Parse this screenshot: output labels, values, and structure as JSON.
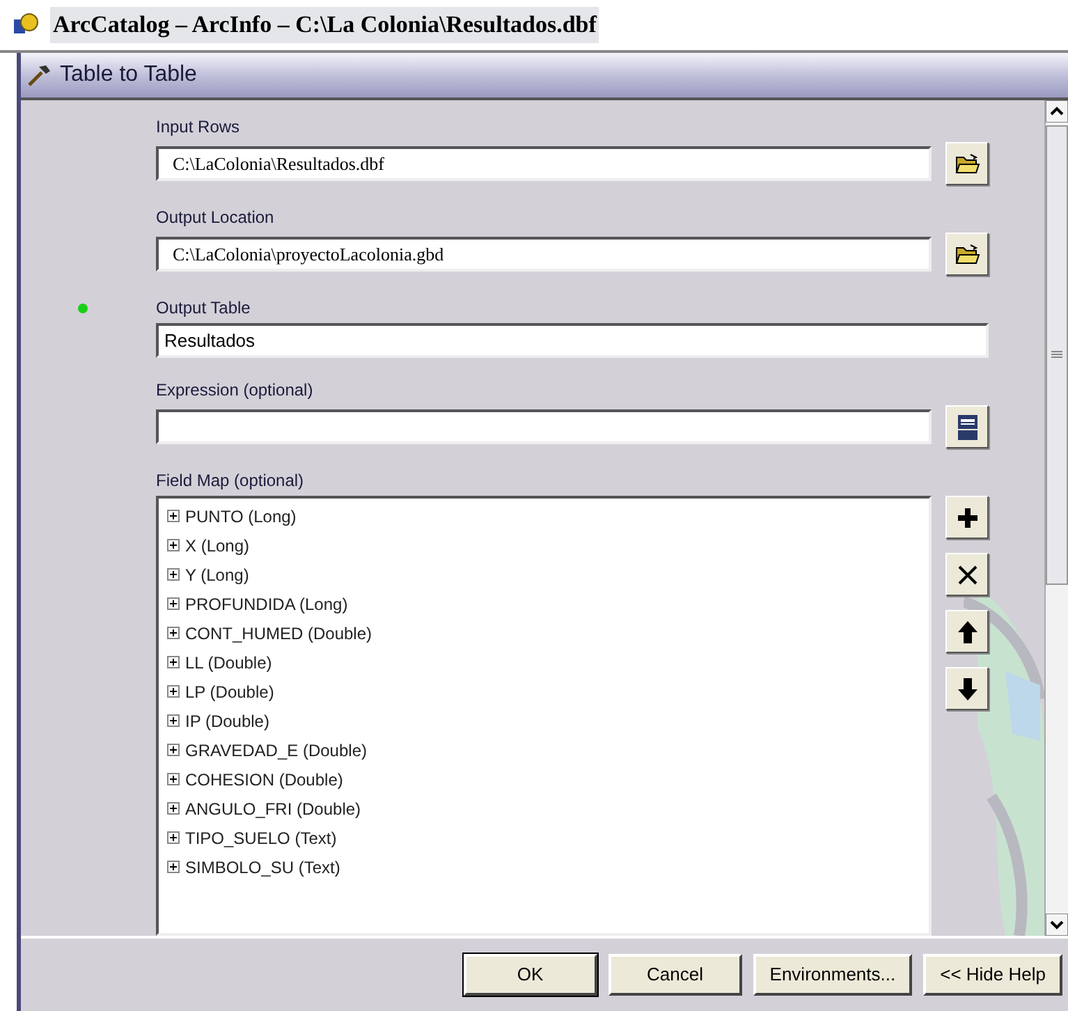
{
  "window": {
    "title": "ArcCatalog – ArcInfo – C:\\La Colonia\\Resultados.dbf"
  },
  "dialog": {
    "title": "Table to Table"
  },
  "fields": [
    {
      "label": "Input Rows",
      "value": "C:\\LaColonia\\Resultados.dbf",
      "required": false,
      "kind": "browse"
    },
    {
      "label": "Output Location",
      "value": "C:\\LaColonia\\proyectoLacolonia.gbd",
      "required": false,
      "kind": "browse"
    },
    {
      "label": "Output Table",
      "value": "Resultados",
      "required": true,
      "kind": "plain"
    },
    {
      "label": "Expression (optional)",
      "required": false,
      "kind": "sql"
    }
  ],
  "field_map": {
    "label": "Field Map (optional)",
    "items": [
      {
        "label": "PUNTO (Long)",
        "expanded": false
      },
      {
        "label": "X (Long)",
        "expanded": false
      },
      {
        "label": "Y (Long)",
        "expanded": false
      },
      {
        "label": "PROFUNDIDA (Long)",
        "expanded": false
      },
      {
        "label": "CONT_HUMED (Double)",
        "expanded": false
      },
      {
        "label": "LL (Double)",
        "expanded": false
      },
      {
        "label": "LP (Double)",
        "expanded": false
      },
      {
        "label": "IP (Double)",
        "expanded": false
      },
      {
        "label": "GRAVEDAD_E (Double)",
        "expanded": false
      },
      {
        "label": "COHESION (Double)",
        "expanded": false
      },
      {
        "label": "ANGULO_FRI (Double)",
        "expanded": false
      },
      {
        "label": "TIPO_SUELO (Text)",
        "expanded": false
      },
      {
        "label": "SIMBOLO_SU (Text)",
        "expanded": false
      }
    ],
    "tools": [
      {
        "kind": "add"
      },
      {
        "kind": "remove"
      },
      {
        "kind": "up"
      },
      {
        "kind": "down"
      }
    ]
  },
  "buttons": [
    "OK",
    "Cancel",
    "Environments...",
    "<< Hide Help"
  ]
}
